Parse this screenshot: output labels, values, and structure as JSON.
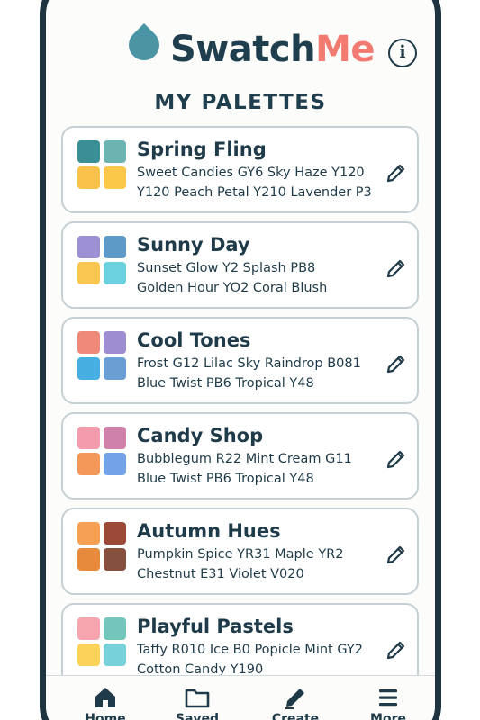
{
  "app": {
    "name_part1": "Swatch",
    "name_part2": "Me",
    "logo_icon": "water-drop-icon",
    "info_icon_glyph": "i",
    "colors": {
      "primary": "#203f4e",
      "accent": "#f27a70",
      "drop": "#4a94a4"
    }
  },
  "page_title": "MY PALETTES",
  "palettes": [
    {
      "name": "Spring Fling",
      "line1": "Sweet Candies GY6  Sky Haze  Y120",
      "line2": "Y120  Peach Petal  Y210  Lavender P3",
      "swatches": [
        "#3a8f94",
        "#6cb3b1",
        "#f8c24b",
        "#fbc849"
      ]
    },
    {
      "name": "Sunny Day",
      "line1": "Sunset Glow  Y2   Splash PB8",
      "line2": "Golden Hour YO2  Coral Blush",
      "swatches": [
        "#9c8fd3",
        "#5d9ac7",
        "#f9c64f",
        "#6ad2df"
      ]
    },
    {
      "name": "Cool Tones",
      "line1": "Frost G12  Lilac Sky  Raindrop B081",
      "line2": "Blue Twist PB6  Tropical Y48",
      "swatches": [
        "#ef8a7b",
        "#9e8ed1",
        "#46aee0",
        "#6b9fd3"
      ]
    },
    {
      "name": "Candy Shop",
      "line1": "Bubblegum R22  Mint Cream G11",
      "line2": "Blue Twist PB6  Tropical Y48",
      "swatches": [
        "#f29cae",
        "#d081a9",
        "#f4985a",
        "#73a3e6"
      ]
    },
    {
      "name": "Autumn Hues",
      "line1": "Pumpkin Spice YR31   Maple YR2",
      "line2": "Chestnut E31  Violet V020",
      "swatches": [
        "#f5a052",
        "#9b4a38",
        "#e78a3b",
        "#86503f"
      ]
    },
    {
      "name": "Playful Pastels",
      "line1": "Taffy R010  Ice B0  Popicle Mint GY2",
      "line2": "Cotton Candy Y190",
      "swatches": [
        "#f6a5ae",
        "#74c6bd",
        "#fcd259",
        "#77d1da"
      ]
    }
  ],
  "nav": [
    {
      "label": "Home",
      "icon": "home-icon"
    },
    {
      "label": "Saved",
      "icon": "folder-icon"
    },
    {
      "label": "Create",
      "icon": "pencil-icon"
    },
    {
      "label": "More",
      "icon": "menu-icon"
    }
  ]
}
